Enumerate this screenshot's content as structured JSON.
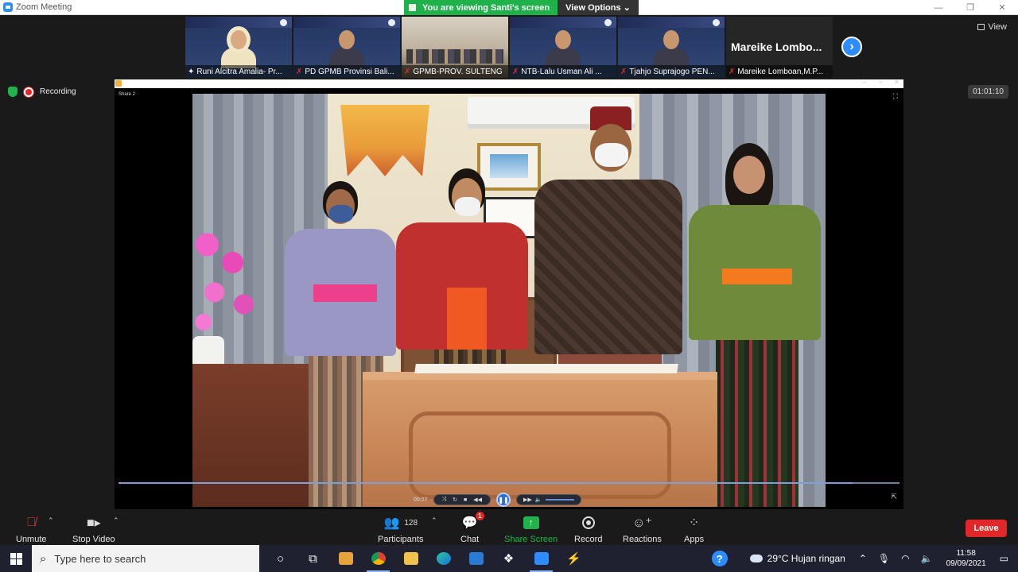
{
  "window": {
    "title": "Zoom Meeting",
    "controls": [
      "—",
      "❐",
      "✕"
    ]
  },
  "banner": {
    "viewing_text": "You are viewing Santi's screen",
    "view_options_label": "View Options ⌄"
  },
  "thumbnails": [
    {
      "name": "Runi Alcitra Amalia- Pr...",
      "muted": false
    },
    {
      "name": "PD GPMB Provinsi Bali...",
      "muted": true
    },
    {
      "name": "GPMB-PROV. SULTENG",
      "muted": true
    },
    {
      "name": "NTB-Lalu Usman Ali ...",
      "muted": true
    },
    {
      "name": "Tjahjo Suprajogo PEN...",
      "muted": true
    },
    {
      "name": "Mareike Lomboan,M.P...",
      "big_name": "Mareike Lombo...",
      "muted": true
    }
  ],
  "view_button": {
    "label": "View"
  },
  "recording": {
    "label": "Recording"
  },
  "timer": {
    "value": "01:01:10"
  },
  "share": {
    "label": "Share 2",
    "player": {
      "time": "00:27",
      "progress_fraction": 0.94
    }
  },
  "toolbar": {
    "unmute": "Unmute",
    "stop_video": "Stop Video",
    "participants": "Participants",
    "participants_count": "128",
    "chat": "Chat",
    "chat_badge": "1",
    "share_screen": "Share Screen",
    "record": "Record",
    "reactions": "Reactions",
    "apps": "Apps",
    "leave": "Leave"
  },
  "taskbar": {
    "search_placeholder": "Type here to search",
    "weather": "29°C  Hujan ringan",
    "time": "11:58",
    "date": "09/09/2021"
  },
  "colors": {
    "accent": "#2d8cff",
    "share_green": "#23b14d",
    "leave_red": "#e02828"
  }
}
